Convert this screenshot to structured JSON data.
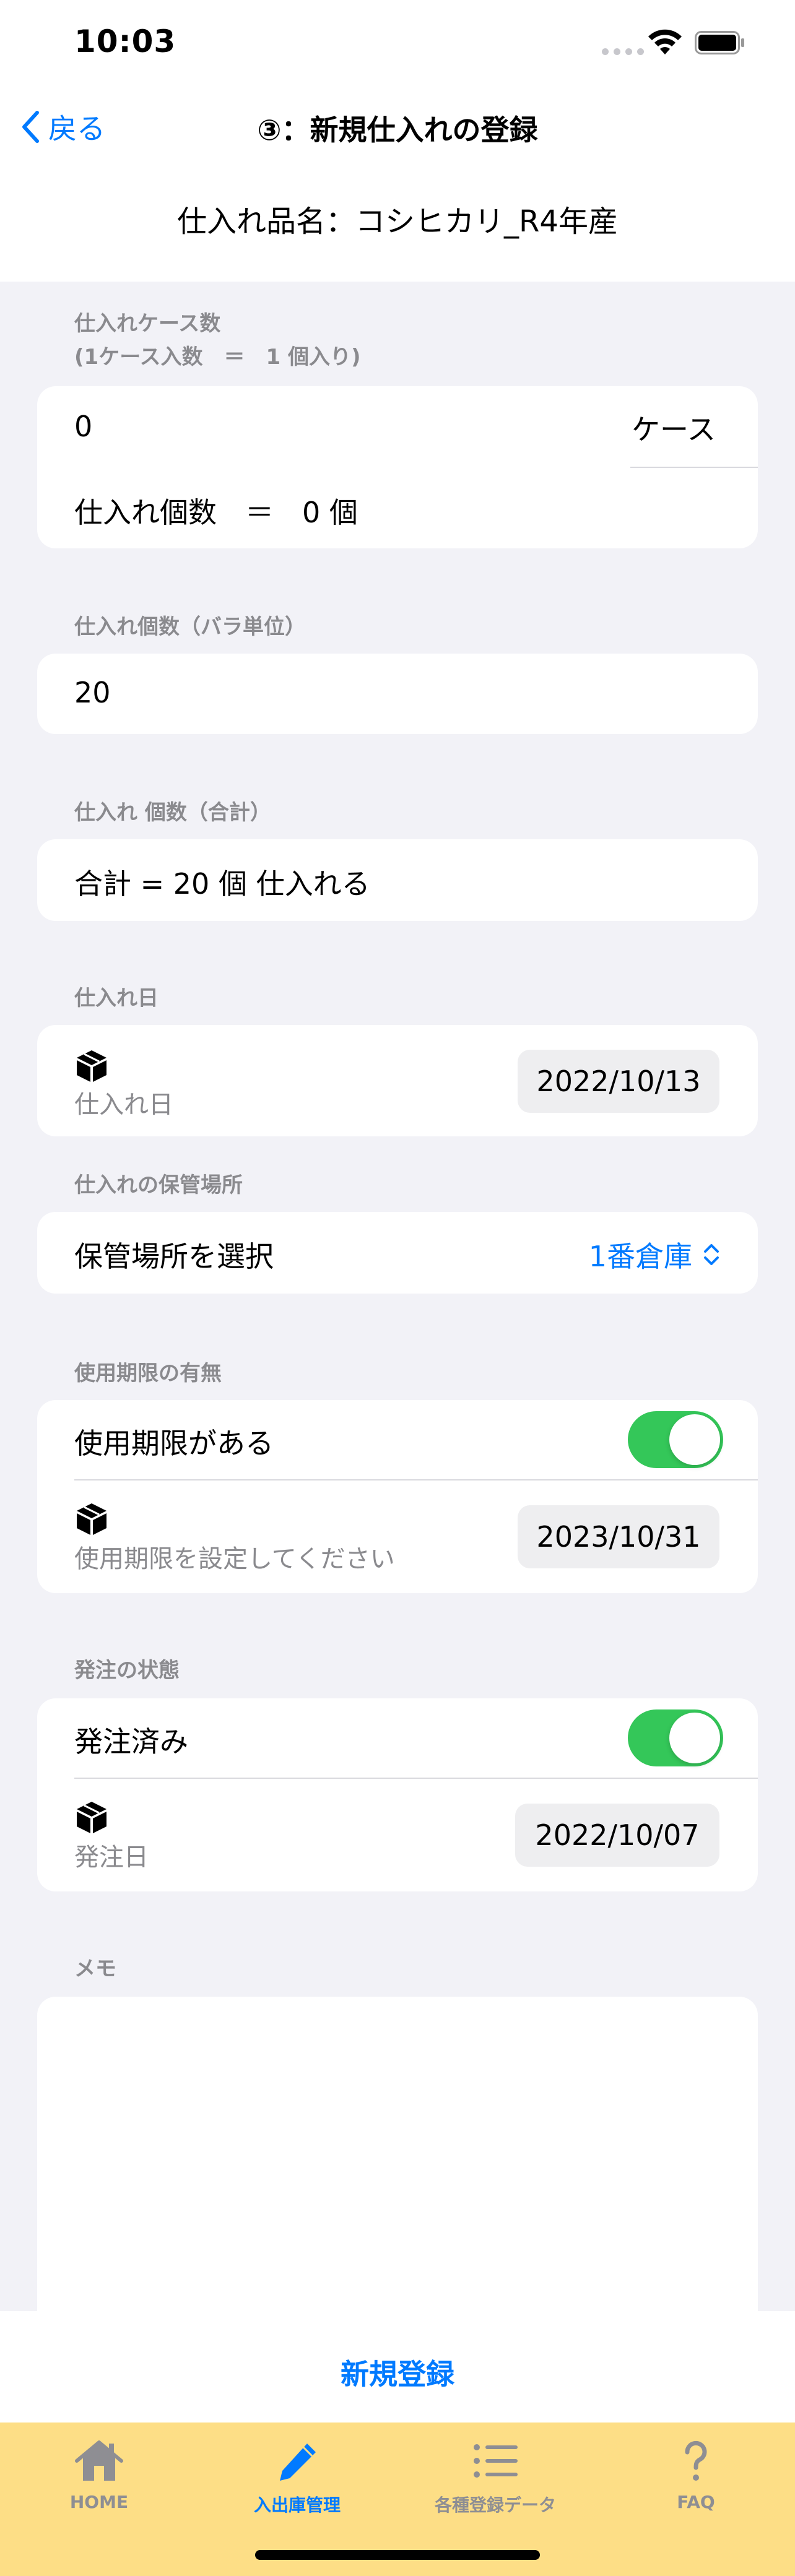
{
  "status_bar": {
    "time": "10:03"
  },
  "nav": {
    "back_label": "戻る",
    "title": "③：新規仕入れの登録"
  },
  "product": {
    "name": "仕入れ品名：コシヒカリ_R4年産"
  },
  "case_section": {
    "label_line1": "仕入れケース数",
    "label_line2": "(1ケース入数　＝　1 個入り)",
    "value": "0",
    "unit": "ケース",
    "computed": "仕入れ個数　＝　0 個"
  },
  "loose_section": {
    "label": "仕入れ個数（バラ単位）",
    "value": "20"
  },
  "total_section": {
    "label": "仕入れ 個数（合計）",
    "value": "合計 = 20 個 仕入れる"
  },
  "date_section": {
    "label": "仕入れ日",
    "row_label": "仕入れ日",
    "date": "2022/10/13"
  },
  "storage_section": {
    "label": "仕入れの保管場所",
    "row_label": "保管場所を選択",
    "selected": "1番倉庫"
  },
  "expiry_section": {
    "label": "使用期限の有無",
    "toggle_label": "使用期限がある",
    "toggle_on": true,
    "date_label": "使用期限を設定してください",
    "date": "2023/10/31"
  },
  "order_section": {
    "label": "発注の状態",
    "toggle_label": "発注済み",
    "toggle_on": true,
    "date_label": "発注日",
    "date": "2022/10/07"
  },
  "memo_section": {
    "label": "メモ",
    "value": ""
  },
  "submit_label": "新規登録",
  "tabs": [
    {
      "label": "HOME",
      "icon": "house-icon",
      "active": false
    },
    {
      "label": "入出庫管理",
      "icon": "pencil-icon",
      "active": true
    },
    {
      "label": "各種登録データ",
      "icon": "list-icon",
      "active": false
    },
    {
      "label": "FAQ",
      "icon": "question-icon",
      "active": false
    }
  ],
  "colors": {
    "accent": "#007AFF",
    "toggle_on": "#34C759",
    "tab_bar_bg": "#FDDE86",
    "background": "#F2F2F7",
    "secondary_text": "#8A8A8E"
  }
}
